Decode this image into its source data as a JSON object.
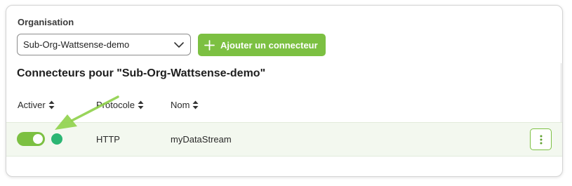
{
  "organisation": {
    "label": "Organisation",
    "selected": "Sub-Org-Wattsense-demo"
  },
  "add_button": {
    "label": "Ajouter un connecteur"
  },
  "section": {
    "title": "Connecteurs pour \"Sub-Org-Wattsense-demo\""
  },
  "table": {
    "columns": [
      "Activer",
      "Protocole",
      "Nom"
    ],
    "rows": [
      {
        "enabled": true,
        "status_color": "#2bb673",
        "protocol": "HTTP",
        "name": "myDataStream"
      }
    ]
  },
  "colors": {
    "accent": "#7cc042",
    "status_ok": "#2bb673",
    "row_bg": "#f3f8ef"
  },
  "icons": {
    "select": "chevron-down-icon",
    "add": "plus-icon",
    "sort": "sort-icon",
    "actions": "more-vertical-icon",
    "annotation": "arrow-annotation-icon"
  }
}
